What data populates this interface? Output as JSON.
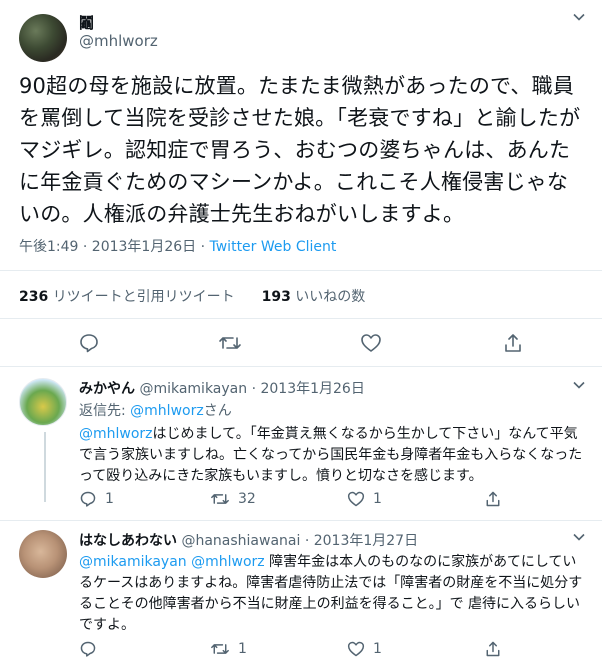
{
  "main_tweet": {
    "author_name": "鬮",
    "author_handle": "@mhlworz",
    "text": "90超の母を施設に放置。たまたま微熱があったので、職員を罵倒して当院を受診させた娘。「老衰ですね」と諭したがマジギレ。認知症で胃ろう、おむつの婆ちゃんは、あんたに年金貢ぐためのマシーンかよ。これこそ人権侵害じゃないの。人権派の弁護士先生おねがいしますよ。",
    "timestamp": "午後1:49 · 2013年1月26日",
    "client": "Twitter Web Client",
    "retweet_count": "236",
    "retweet_label": "リツイートと引用リツイート",
    "like_count": "193",
    "like_label": "いいねの数"
  },
  "replies": [
    {
      "name": "みかやん",
      "handle": "@mikamikayan",
      "date": "· 2013年1月26日",
      "reply_prefix": "返信先:",
      "reply_to": "@mhlworz",
      "reply_suffix": "さん",
      "mention": "@mhlworz",
      "text": "はじめまして。「年金貰え無くなるから生かして下さい」なんて平気で言う家族いますしね。亡くなってから国民年金も身障者年金も入らなくなったって殴り込みにきた家族もいますし。憤りと切なさを感じます。",
      "reply_count": "1",
      "retweet_count": "32",
      "like_count": "1"
    },
    {
      "name": "はなしあわない",
      "handle": "@hanashiawanai",
      "date": "· 2013年1月27日",
      "mentions": "@mikamikayan @mhlworz",
      "text": "障害年金は本人のものなのに家族があてにしているケースはありますよね。障害者虐待防止法では「障害者の財産を不当に処分することその他障害者から不当に財産上の利益を得ること。」で 虐待に入るらしいですよ。",
      "retweet_count": "1",
      "like_count": "1"
    }
  ],
  "icons": [
    "chevron-down-icon",
    "reply-icon",
    "retweet-icon",
    "like-icon",
    "share-icon"
  ],
  "colors": {
    "accent": "#1d9bf0",
    "muted": "#536471",
    "text": "#0f1419",
    "divider": "#e6ecf0"
  }
}
